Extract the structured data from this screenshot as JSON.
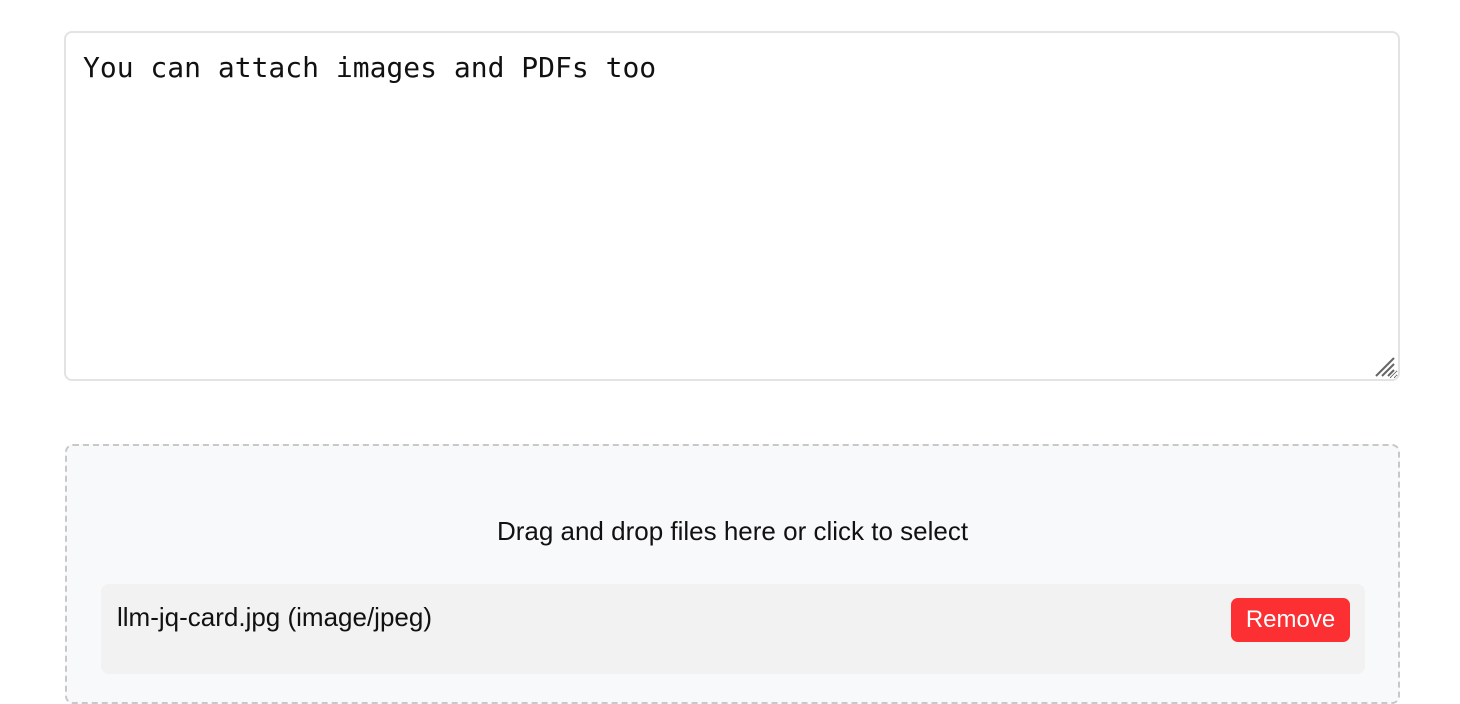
{
  "prompt": {
    "value": "You can attach images and PDFs too"
  },
  "dropzone": {
    "label": "Drag and drop files here or click to select",
    "files": [
      {
        "name": "llm-jq-card.jpg (image/jpeg)",
        "remove_label": "Remove"
      }
    ]
  },
  "colors": {
    "remove_button": "#fc2f32",
    "dropzone_bg": "#f8f9fa",
    "file_row_bg": "#f2f2f2"
  }
}
